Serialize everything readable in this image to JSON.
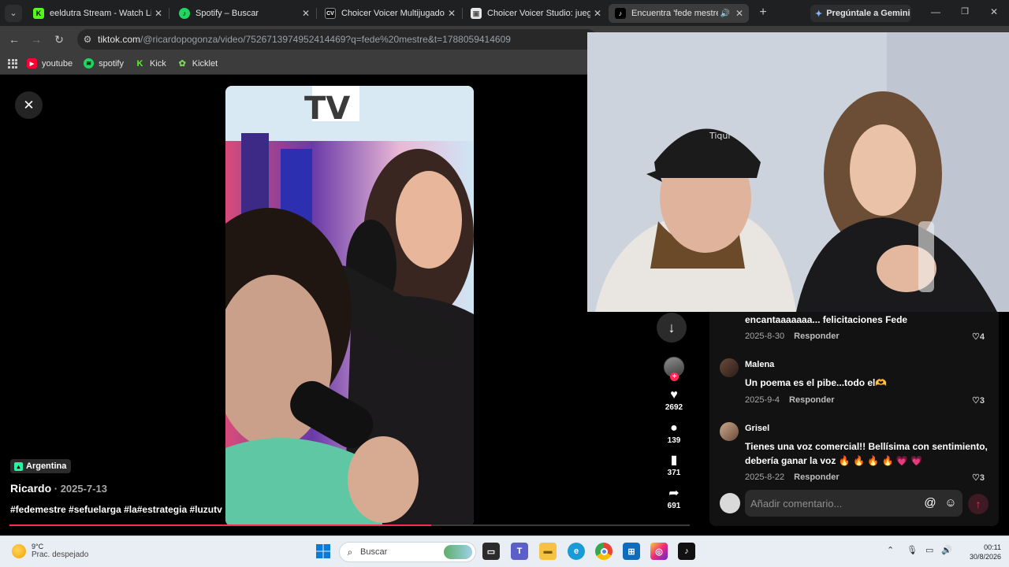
{
  "browser": {
    "tabs": [
      {
        "title": "eeldutra Stream - Watch Live on Kick",
        "icon": "kick-icon",
        "color": "#53fc18",
        "glyph": "K"
      },
      {
        "title": "Spotify – Buscar",
        "icon": "spotify-icon",
        "color": "#1ed760",
        "glyph": "♪"
      },
      {
        "title": "Choicer Voicer Multijugador: Juego",
        "icon": "cv-icon",
        "color": "#111111",
        "glyph": "CV"
      },
      {
        "title": "Choicer Voicer Studio: juego de voces",
        "icon": "page-icon",
        "color": "#e8e8e8",
        "glyph": "▣"
      },
      {
        "title": "Encuentra 'fede mestre' en TikTok",
        "icon": "tiktok-icon",
        "color": "#000000",
        "glyph": "♪"
      }
    ],
    "gemini_label": "Pregúntale a Gemini",
    "url_host": "tiktok.com",
    "url_path": "/@ricardopogonza/video/7526713974952414469?q=fede%20mestre&t=1788059414609",
    "bookmarks": [
      {
        "label": "youtube",
        "icon": "youtube-icon",
        "color": "#ff0033",
        "glyph": "▶"
      },
      {
        "label": "spotify",
        "icon": "spotify-icon",
        "color": "#1ed760",
        "glyph": "≋"
      },
      {
        "label": "Kick",
        "icon": "kick-icon",
        "color": "#53fc18",
        "glyph": "K"
      },
      {
        "label": "Kicklet",
        "icon": "kicklet-icon",
        "color": "#7bd45b",
        "glyph": "✿"
      }
    ]
  },
  "video": {
    "progress": 0.62,
    "country": "Argentina",
    "author": "Ricardo",
    "date": "2025-7-13",
    "hashtags": "#fedemestre #sefuelarga #la#estrategia #luzutv"
  },
  "actions": {
    "likes": "2692",
    "comments": "139",
    "saves": "371",
    "shares": "691"
  },
  "comments": [
    {
      "user": "",
      "text": "encantaaaaaaa... felicitaciones Fede",
      "date": "2025-8-30",
      "reply": "Responder",
      "likes": "4"
    },
    {
      "user": "Malena",
      "text": "Un poema es el pibe...todo el🫶",
      "date": "2025-9-4",
      "reply": "Responder",
      "likes": "3"
    },
    {
      "user": "Grisel",
      "text": "Tienes una voz comercial!! Bellísima con sentimiento, debería ganar la voz 🔥 🔥 🔥 🔥 💗 💗",
      "date": "2025-8-22",
      "reply": "Responder",
      "likes": "3"
    }
  ],
  "composer": {
    "placeholder": "Añadir comentario..."
  },
  "taskbar": {
    "temp": "9°C",
    "weather": "Prac. despejado",
    "search": "Buscar",
    "time": "00:11",
    "date": "30/8/2026"
  }
}
